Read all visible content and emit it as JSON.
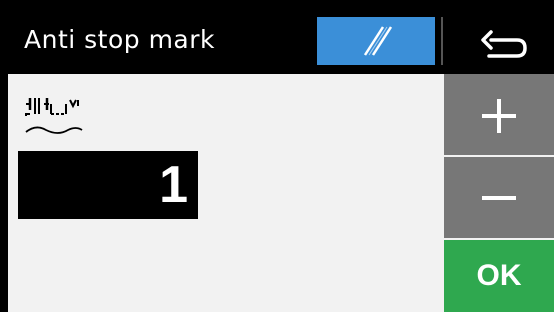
{
  "header": {
    "title": "Anti stop mark",
    "mode_icon": "double-slash-icon",
    "back_icon": "return-arrow-icon"
  },
  "content": {
    "setting_icon": "anti-stop-mark-stitch-icon",
    "value": "1"
  },
  "controls": {
    "plus_icon": "plus-icon",
    "minus_icon": "minus-icon",
    "ok_label": "OK"
  },
  "colors": {
    "accent_blue": "#3b8fd8",
    "button_gray": "#777777",
    "ok_green": "#2fa84f",
    "background": "#f2f2f2"
  }
}
